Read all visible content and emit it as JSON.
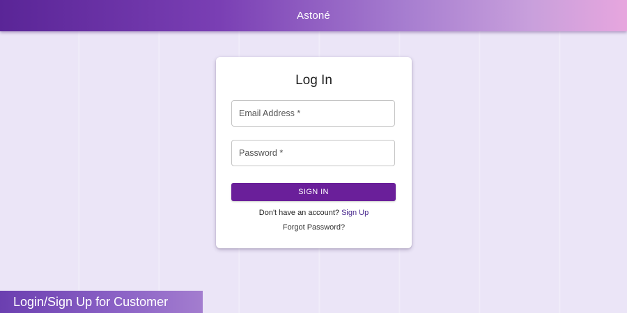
{
  "header": {
    "brand": "Astoné"
  },
  "login": {
    "title": "Log In",
    "email_label": "Email Address *",
    "password_label": "Password *",
    "signin_label": "SIGN IN",
    "signup_prompt": "Don't have an account?",
    "signup_link": "Sign Up",
    "forgot_link": "Forgot Password?"
  },
  "caption": {
    "text": "Login/Sign Up for Customer"
  },
  "colors": {
    "accent": "#6a1f9a",
    "background": "#ebe5f7",
    "header_start": "#5a2597",
    "header_end": "#e7a6de"
  }
}
